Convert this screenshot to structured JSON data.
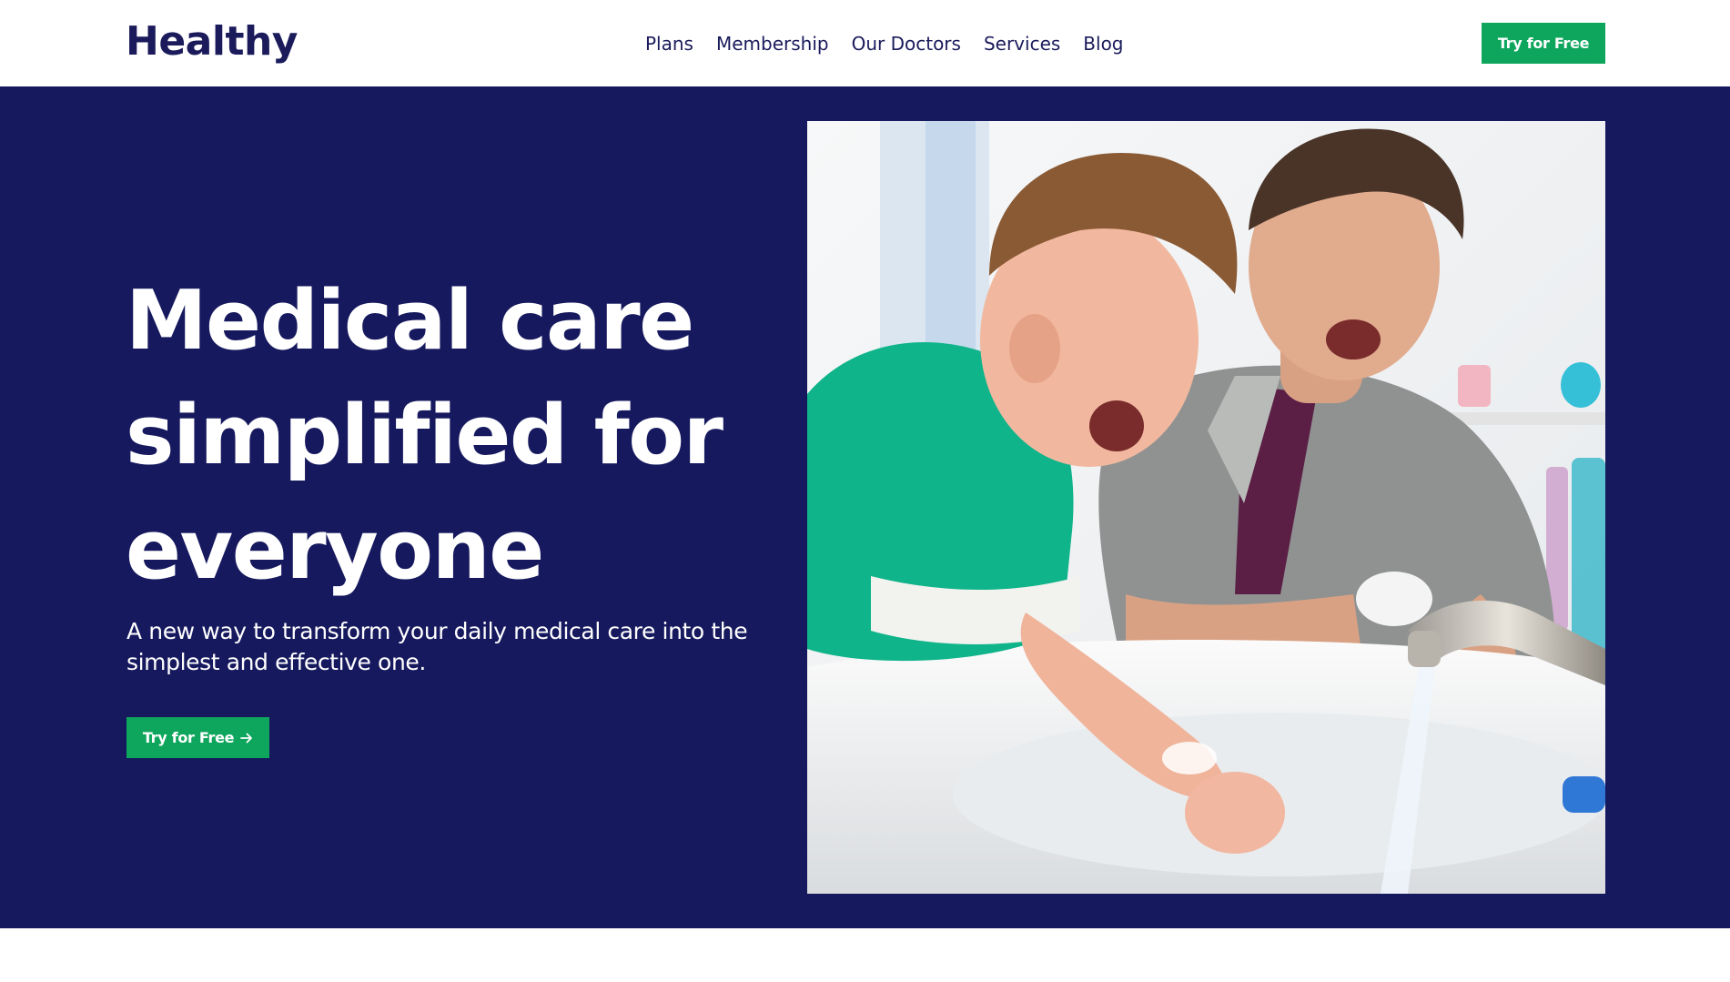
{
  "header": {
    "logo": "Healthy",
    "nav": [
      "Plans",
      "Membership",
      "Our Doctors",
      "Services",
      "Blog"
    ],
    "cta_label": "Try for Free"
  },
  "hero": {
    "title_lines": [
      "Medical care",
      "simplified for",
      "everyone"
    ],
    "subtitle": "A new way to transform your daily medical care into the simplest and effective one.",
    "cta_label": "Try for Free",
    "cta_icon": "arrow-right-icon",
    "image": "father-and-son-washing-hands-photo"
  },
  "colors": {
    "brand_navy": "#16195e",
    "logo_text": "#1b1b5c",
    "cta_green": "#0ea65d",
    "text_on_dark": "#ffffff"
  }
}
